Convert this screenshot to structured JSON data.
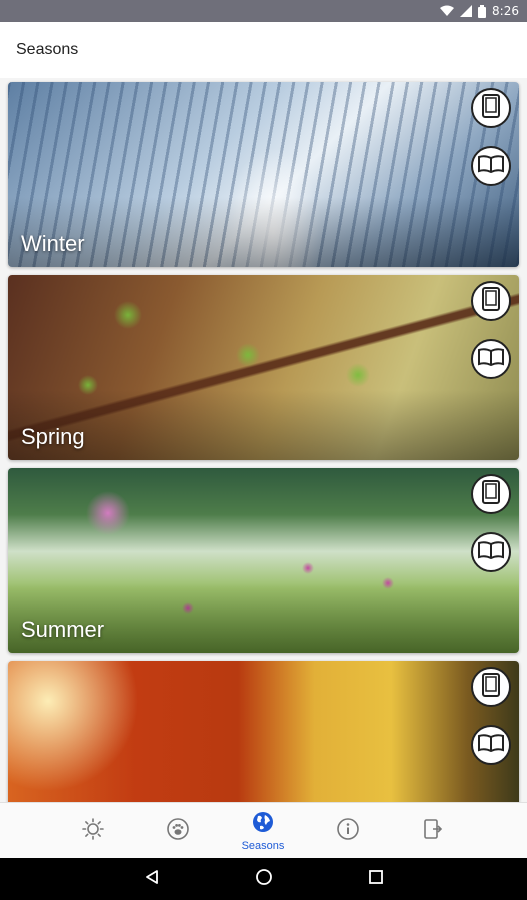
{
  "status_bar": {
    "time": "8:26"
  },
  "app_bar": {
    "title": "Seasons"
  },
  "cards": [
    {
      "label": "Winter"
    },
    {
      "label": "Spring"
    },
    {
      "label": "Summer"
    },
    {
      "label": ""
    }
  ],
  "card_icons": {
    "phone": "phone-icon",
    "book": "book-icon"
  },
  "bottom_nav": {
    "items": [
      {
        "icon": "sun-icon"
      },
      {
        "icon": "paw-icon"
      },
      {
        "icon": "globe-icon",
        "label": "Seasons",
        "active": true
      },
      {
        "icon": "info-icon"
      },
      {
        "icon": "share-screen-icon"
      }
    ],
    "active_color": "#1e5bd6"
  },
  "colors": {
    "status_bar": "#6f6f7a",
    "accent": "#1e5bd6"
  }
}
